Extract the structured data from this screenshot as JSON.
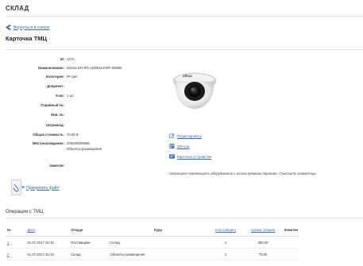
{
  "app": {
    "title": "СКЛАД"
  },
  "nav": {
    "back_label": "Вернуться в список"
  },
  "page": {
    "title": "Карточка ТМЦ"
  },
  "fields": [
    {
      "label": "id:",
      "value": "1272"
    },
    {
      "label": "Наименование:",
      "value": "Dahua DH-IPC-HDW1120SP-0280B"
    },
    {
      "label": "Категория:",
      "value": "IP-cam"
    },
    {
      "label": "Документ:",
      "value": ""
    },
    {
      "label": "К-во:",
      "value": "1 шт."
    },
    {
      "label": "Серийный №:",
      "value": ""
    },
    {
      "label": "Инв. №:",
      "value": ""
    },
    {
      "label": "Штрихкод:",
      "value": ""
    },
    {
      "label": "Общая стоимость:",
      "value": "70.00 $"
    },
    {
      "label": "Местонахождение:",
      "value": "206030000655",
      "value2": "Объекты размещения"
    },
    {
      "label": "Заметки:",
      "value": ""
    }
  ],
  "product_image": {
    "brand": "alhua"
  },
  "actions": {
    "edit_label": "Редактировать",
    "qr_label": "QR-код",
    "device_card_label": "Карточка устройства"
  },
  "warning": "Запрещено перемещать оборудование с используемыми портами. Очистите коммутаци",
  "attach": {
    "label": "Прикрепить файл"
  },
  "operations": {
    "title": "Операции с ТМЦ",
    "columns": [
      "№",
      "Дата",
      "Откуда",
      "Куда",
      "К-во (общее)",
      "Сумма (общая)",
      "Заметки"
    ],
    "rows": [
      {
        "num": "1",
        "date": "01.07.2017 16:15",
        "from": "Поставщики",
        "to": "Склад",
        "qty": "1",
        "sum": "350.00",
        "notes": ""
      },
      {
        "num": "2",
        "date": "01.07.2017 16:19",
        "from": "Склад",
        "to": "Объекты размещения",
        "qty": "1",
        "sum": "70.00",
        "notes": ""
      }
    ]
  },
  "colors": {
    "link": "#2a6ebb",
    "text": "#333333",
    "divider": "#e3e3e3"
  }
}
